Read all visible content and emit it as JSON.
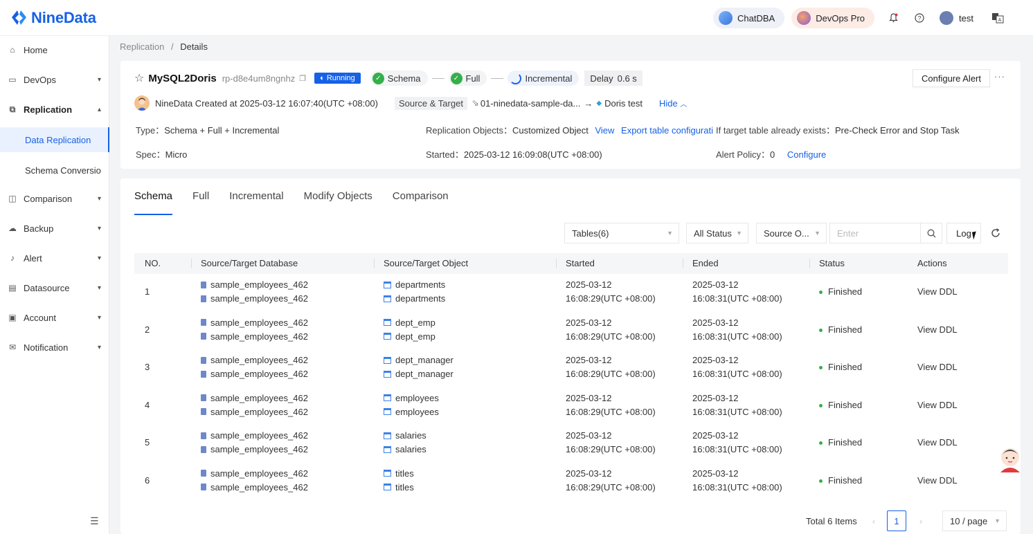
{
  "app": {
    "logo_text": "NineData"
  },
  "topbar": {
    "chat_label": "ChatDBA",
    "devops_label": "DevOps Pro",
    "username": "test"
  },
  "sidebar": {
    "items": [
      {
        "label": "Home",
        "icon": "home-icon"
      },
      {
        "label": "DevOps",
        "icon": "monitor-icon"
      },
      {
        "label": "Replication",
        "icon": "replication-icon"
      },
      {
        "label": "Comparison",
        "icon": "compare-icon"
      },
      {
        "label": "Backup",
        "icon": "cloud-icon"
      },
      {
        "label": "Alert",
        "icon": "bell-icon"
      },
      {
        "label": "Datasource",
        "icon": "database-icon"
      },
      {
        "label": "Account",
        "icon": "account-icon"
      },
      {
        "label": "Notification",
        "icon": "mail-icon"
      }
    ],
    "sub_items": [
      {
        "label": "Data Replication"
      },
      {
        "label": "Schema Conversio"
      }
    ]
  },
  "breadcrumb": {
    "parent": "Replication",
    "sep": "/",
    "current": "Details"
  },
  "task": {
    "name": "MySQL2Doris",
    "id": "rp-d8e4um8ngnhz",
    "status": "Running",
    "stages": [
      "Schema",
      "Full",
      "Incremental"
    ],
    "delay_label": "Delay",
    "delay_value": "0.6 s",
    "configure_alert": "Configure Alert",
    "more": "···",
    "creator_text": "NineData Created at 2025-03-12 16:07:40(UTC +08:00)",
    "source_target_label": "Source & Target",
    "source": "01-ninedata-sample-da...",
    "target": "Doris test",
    "hide": "Hide",
    "type_label": "Type：",
    "type_value": "Schema + Full + Incremental",
    "objects_label": "Replication Objects：",
    "objects_value": "Customized Object",
    "view": "View",
    "export": "Export table configurati",
    "if_exists_label": "If target table already exists：",
    "if_exists_value": "Pre-Check Error and Stop Task",
    "spec_label": "Spec：",
    "spec_value": "Micro",
    "started_label": "Started：",
    "started_value": "2025-03-12 16:09:08(UTC +08:00)",
    "alert_policy_label": "Alert Policy：",
    "alert_policy_value": "0",
    "configure": "Configure"
  },
  "tabs": [
    "Schema",
    "Full",
    "Incremental",
    "Modify Objects",
    "Comparison"
  ],
  "filters": {
    "tables": "Tables(6)",
    "status": "All Status",
    "source": "Source O...",
    "search_placeholder": "Enter",
    "log": "Log"
  },
  "table": {
    "headers": [
      "NO.",
      "Source/Target Database",
      "Source/Target Object",
      "Started",
      "Ended",
      "Status",
      "Actions"
    ],
    "rows": [
      {
        "no": "1",
        "db1": "sample_employees_462",
        "db2": "sample_employees_462",
        "obj1": "departments",
        "obj2": "departments",
        "s_date": "2025-03-12",
        "s_time": "16:08:29(UTC +08:00)",
        "e_date": "2025-03-12",
        "e_time": "16:08:31(UTC +08:00)",
        "status": "Finished",
        "action": "View DDL"
      },
      {
        "no": "2",
        "db1": "sample_employees_462",
        "db2": "sample_employees_462",
        "obj1": "dept_emp",
        "obj2": "dept_emp",
        "s_date": "2025-03-12",
        "s_time": "16:08:29(UTC +08:00)",
        "e_date": "2025-03-12",
        "e_time": "16:08:31(UTC +08:00)",
        "status": "Finished",
        "action": "View DDL"
      },
      {
        "no": "3",
        "db1": "sample_employees_462",
        "db2": "sample_employees_462",
        "obj1": "dept_manager",
        "obj2": "dept_manager",
        "s_date": "2025-03-12",
        "s_time": "16:08:29(UTC +08:00)",
        "e_date": "2025-03-12",
        "e_time": "16:08:31(UTC +08:00)",
        "status": "Finished",
        "action": "View DDL"
      },
      {
        "no": "4",
        "db1": "sample_employees_462",
        "db2": "sample_employees_462",
        "obj1": "employees",
        "obj2": "employees",
        "s_date": "2025-03-12",
        "s_time": "16:08:29(UTC +08:00)",
        "e_date": "2025-03-12",
        "e_time": "16:08:31(UTC +08:00)",
        "status": "Finished",
        "action": "View DDL"
      },
      {
        "no": "5",
        "db1": "sample_employees_462",
        "db2": "sample_employees_462",
        "obj1": "salaries",
        "obj2": "salaries",
        "s_date": "2025-03-12",
        "s_time": "16:08:29(UTC +08:00)",
        "e_date": "2025-03-12",
        "e_time": "16:08:31(UTC +08:00)",
        "status": "Finished",
        "action": "View DDL"
      },
      {
        "no": "6",
        "db1": "sample_employees_462",
        "db2": "sample_employees_462",
        "obj1": "titles",
        "obj2": "titles",
        "s_date": "2025-03-12",
        "s_time": "16:08:29(UTC +08:00)",
        "e_date": "2025-03-12",
        "e_time": "16:08:31(UTC +08:00)",
        "status": "Finished",
        "action": "View DDL"
      }
    ]
  },
  "pagination": {
    "total": "Total 6 Items",
    "page": "1",
    "page_size": "10 / page"
  },
  "colors": {
    "accent": "#1661e6",
    "success": "#34b04a"
  }
}
